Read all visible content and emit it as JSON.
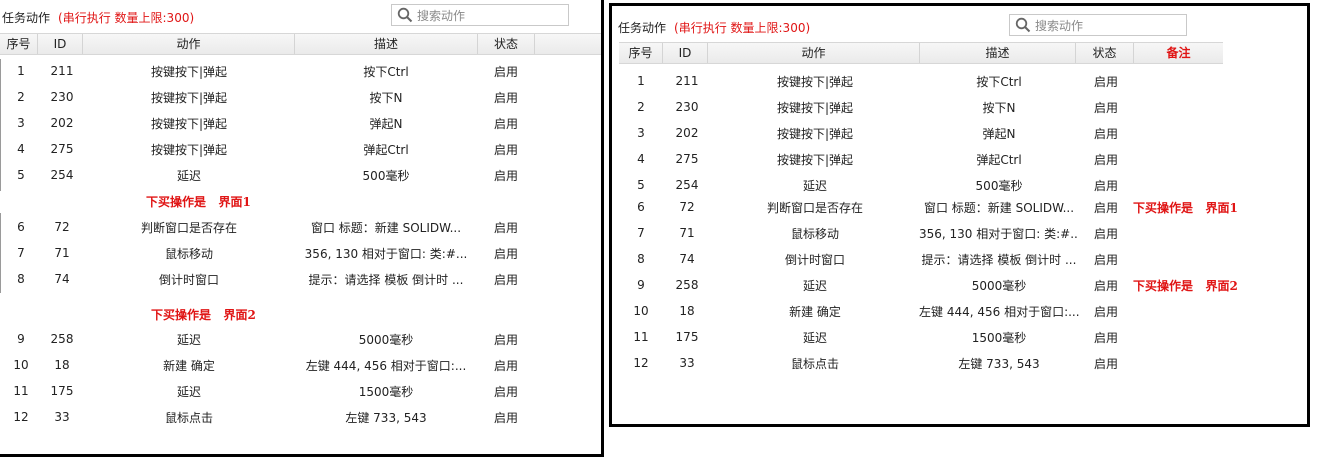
{
  "left": {
    "title": "任务动作",
    "subtitle": "(串行执行 数量上限:300)",
    "search_placeholder": "搜索动作",
    "headers": [
      "序号",
      "ID",
      "动作",
      "描述",
      "状态"
    ],
    "rows": [
      [
        "1",
        "211",
        "按键按下|弹起",
        "按下Ctrl",
        "启用"
      ],
      [
        "2",
        "230",
        "按键按下|弹起",
        "按下N",
        "启用"
      ],
      [
        "3",
        "202",
        "按键按下|弹起",
        "弹起N",
        "启用"
      ],
      [
        "4",
        "275",
        "按键按下|弹起",
        "弹起Ctrl",
        "启用"
      ],
      [
        "5",
        "254",
        "延迟",
        "500毫秒",
        "启用"
      ],
      [
        "6",
        "72",
        "判断窗口是否存在",
        "窗口 标题：新建 SOLIDW...",
        "启用"
      ],
      [
        "7",
        "71",
        "鼠标移动",
        "356, 130 相对于窗口: 类:#...",
        "启用"
      ],
      [
        "8",
        "74",
        "倒计时窗口",
        "提示：请选择 模板 倒计时 ...",
        "启用"
      ],
      [
        "9",
        "258",
        "延迟",
        "5000毫秒",
        "启用"
      ],
      [
        "10",
        "18",
        "新建 确定",
        "左键 444, 456 相对于窗口:...",
        "启用"
      ],
      [
        "11",
        "175",
        "延迟",
        "1500毫秒",
        "启用"
      ],
      [
        "12",
        "33",
        "鼠标点击",
        "左键 733, 543",
        "启用"
      ]
    ],
    "note1": "下买操作是   界面1",
    "note2": "下买操作是   界面2"
  },
  "right": {
    "title": "任务动作",
    "subtitle": "(串行执行 数量上限:300)",
    "search_placeholder": "搜索动作",
    "headers": [
      "序号",
      "ID",
      "动作",
      "描述",
      "状态",
      "备注"
    ],
    "rows": [
      [
        "1",
        "211",
        "按键按下|弹起",
        "按下Ctrl",
        "启用",
        ""
      ],
      [
        "2",
        "230",
        "按键按下|弹起",
        "按下N",
        "启用",
        ""
      ],
      [
        "3",
        "202",
        "按键按下|弹起",
        "弹起N",
        "启用",
        ""
      ],
      [
        "4",
        "275",
        "按键按下|弹起",
        "弹起Ctrl",
        "启用",
        ""
      ],
      [
        "5",
        "254",
        "延迟",
        "500毫秒",
        "启用",
        ""
      ],
      [
        "6",
        "72",
        "判断窗口是否存在",
        "窗口 标题：新建 SOLIDW...",
        "启用",
        "下买操作是   界面1"
      ],
      [
        "7",
        "71",
        "鼠标移动",
        "356, 130 相对于窗口: 类:#...",
        "启用",
        ""
      ],
      [
        "8",
        "74",
        "倒计时窗口",
        "提示：请选择 模板 倒计时 ...",
        "启用",
        ""
      ],
      [
        "9",
        "258",
        "延迟",
        "5000毫秒",
        "启用",
        "下买操作是   界面2"
      ],
      [
        "10",
        "18",
        "新建 确定",
        "左键 444, 456 相对于窗口:...",
        "启用",
        ""
      ],
      [
        "11",
        "175",
        "延迟",
        "1500毫秒",
        "启用",
        ""
      ],
      [
        "12",
        "33",
        "鼠标点击",
        "左键 733, 543",
        "启用",
        ""
      ]
    ]
  },
  "colors": {
    "accent_red": "#e01515",
    "border": "#000000"
  },
  "icons": {
    "search": "search-icon"
  }
}
